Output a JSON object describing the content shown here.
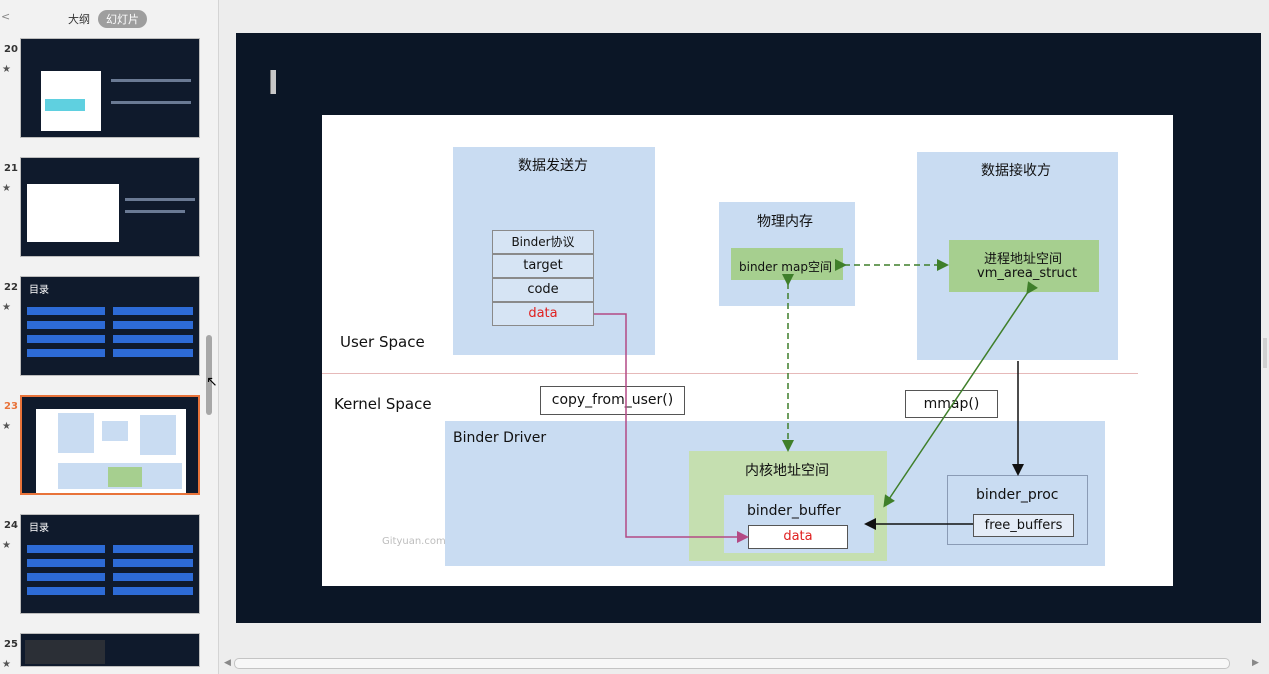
{
  "sidebar": {
    "back": "<",
    "tab_outline": "大纲",
    "tab_slides": "幻灯片",
    "star": "★",
    "thumbs": [
      {
        "num": "20"
      },
      {
        "num": "21"
      },
      {
        "num": "22",
        "title": "目录"
      },
      {
        "num": "23"
      },
      {
        "num": "24",
        "title": "目录"
      },
      {
        "num": "25"
      }
    ]
  },
  "slide": {
    "figure": {
      "sender_title": "数据发送方",
      "sender_rows": [
        "Binder协议",
        "target",
        "code",
        "data"
      ],
      "phys_title": "物理内存",
      "phys_inner": "binder map空间",
      "receiver_title": "数据接收方",
      "receiver_inner_1": "进程地址空间",
      "receiver_inner_2": "vm_area_struct",
      "user_space": "User Space",
      "kernel_space": "Kernel Space",
      "copy_from_user": "copy_from_user()",
      "mmap": "mmap()",
      "binder_driver": "Binder Driver",
      "kernel_addr_title": "内核地址空间",
      "binder_buffer": "binder_buffer",
      "data": "data",
      "binder_proc": "binder_proc",
      "free_buffers": "free_buffers",
      "watermark": "Gityuan.com"
    }
  },
  "colors": {
    "data_red": "#e02020",
    "arrow_green": "#3f7f2a",
    "arrow_pink": "#b34a85",
    "divider": "#e6b9b9"
  }
}
